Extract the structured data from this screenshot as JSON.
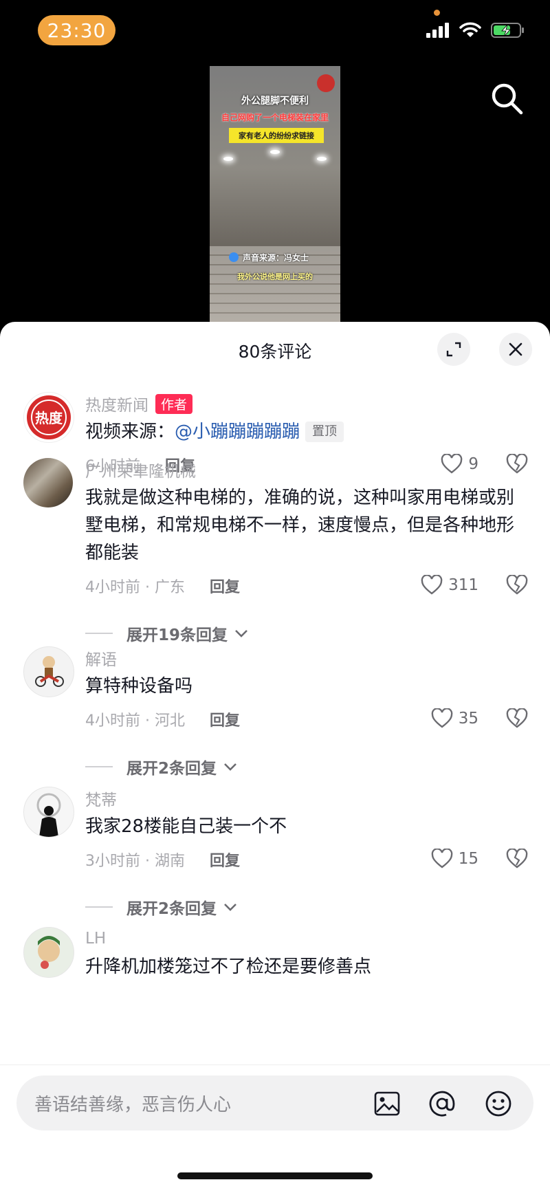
{
  "status_bar": {
    "time": "23:30"
  },
  "video": {
    "title": "外公腿脚不便利",
    "red_caption": "自己网购了一个电梯装在家里",
    "yellow_caption": "家有老人的纷纷求链接",
    "sound_source": "声音来源：冯女士",
    "subtitle": "我外公说他是网上买的"
  },
  "sheet": {
    "title": "80条评论"
  },
  "comments": [
    {
      "user": "热度新闻",
      "author_tag": "作者",
      "text_prefix": "视频来源：",
      "mention": "@小蹦蹦蹦蹦蹦",
      "pin": "置顶",
      "time": "6小时前",
      "reply": "回复",
      "likes": "9"
    },
    {
      "user": "广州荣聿隆机械",
      "text": "我就是做这种电梯的，准确的说，这种叫家用电梯或别墅电梯，和常规电梯不一样，速度慢点，但是各种地形都能装",
      "time": "4小时前 · 广东",
      "reply": "回复",
      "likes": "311",
      "expand": "展开19条回复"
    },
    {
      "user": "解语",
      "text": "算特种设备吗",
      "time": "4小时前 · 河北",
      "reply": "回复",
      "likes": "35",
      "expand": "展开2条回复"
    },
    {
      "user": "梵蒂",
      "text": "我家28楼能自己装一个不",
      "time": "3小时前 · 湖南",
      "reply": "回复",
      "likes": "15",
      "expand": "展开2条回复"
    },
    {
      "user": "LH",
      "text": "升降机加楼笼过不了检还是要修善点"
    }
  ],
  "input": {
    "placeholder": "善语结善缘，恶言伤人心"
  },
  "icons": [
    "signal-icon",
    "wifi-icon",
    "battery-icon",
    "search-icon",
    "expand-icon",
    "close-icon",
    "heart-icon",
    "dislike-icon",
    "image-icon",
    "at-icon",
    "emoji-icon"
  ]
}
